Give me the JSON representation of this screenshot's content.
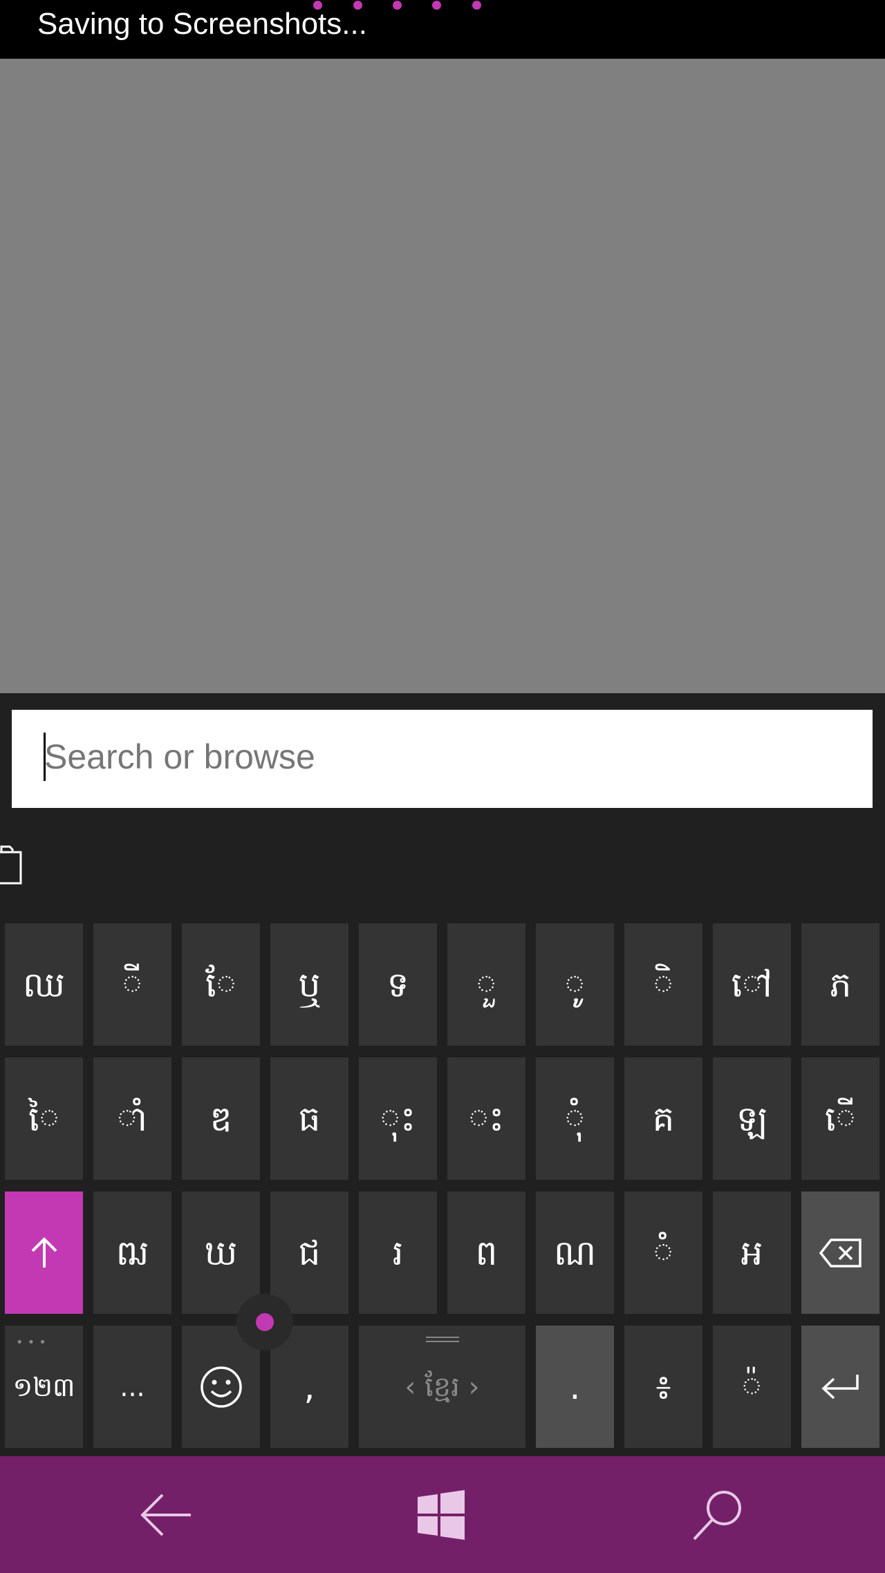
{
  "status_bar": {
    "text": "Saving to Screenshots..."
  },
  "address_bar": {
    "placeholder": "Search or browse",
    "value": ""
  },
  "keyboard": {
    "row1": [
      "ឈ",
      "ី",
      "ែ",
      "ឬ",
      "ទ",
      "ួ",
      "ូ",
      "ិ",
      "ៅ",
      "ភ"
    ],
    "row2": [
      "ៃ",
      "ាំ",
      "ឌ",
      "ធ",
      "ុះ",
      "ះ",
      "ុំ",
      "គ",
      "ឡ",
      "ើ"
    ],
    "row3": [
      "ឍ",
      "ឃ",
      "ជ",
      "រ",
      "ព",
      "ណ",
      "ំ",
      "អ"
    ],
    "numbers_label": "១២៣",
    "ellipsis_label": "...",
    "comma_label": ",",
    "space_label": "ខ្មែរ",
    "period_label": ".",
    "colon_label": "៖",
    "diacritic_label": "៉"
  },
  "colors": {
    "accent": "#c239b3",
    "navbar": "#742069",
    "key": "#343434",
    "key_gray": "#4f4f4f",
    "page_gray": "#808080"
  },
  "icons": {
    "shift": "arrow-up-icon",
    "backspace": "backspace-icon",
    "enter": "enter-icon",
    "emoji": "smiley-icon",
    "back": "back-arrow-icon",
    "start": "windows-logo-icon",
    "search": "search-icon",
    "clipboard": "clipboard-icon"
  }
}
